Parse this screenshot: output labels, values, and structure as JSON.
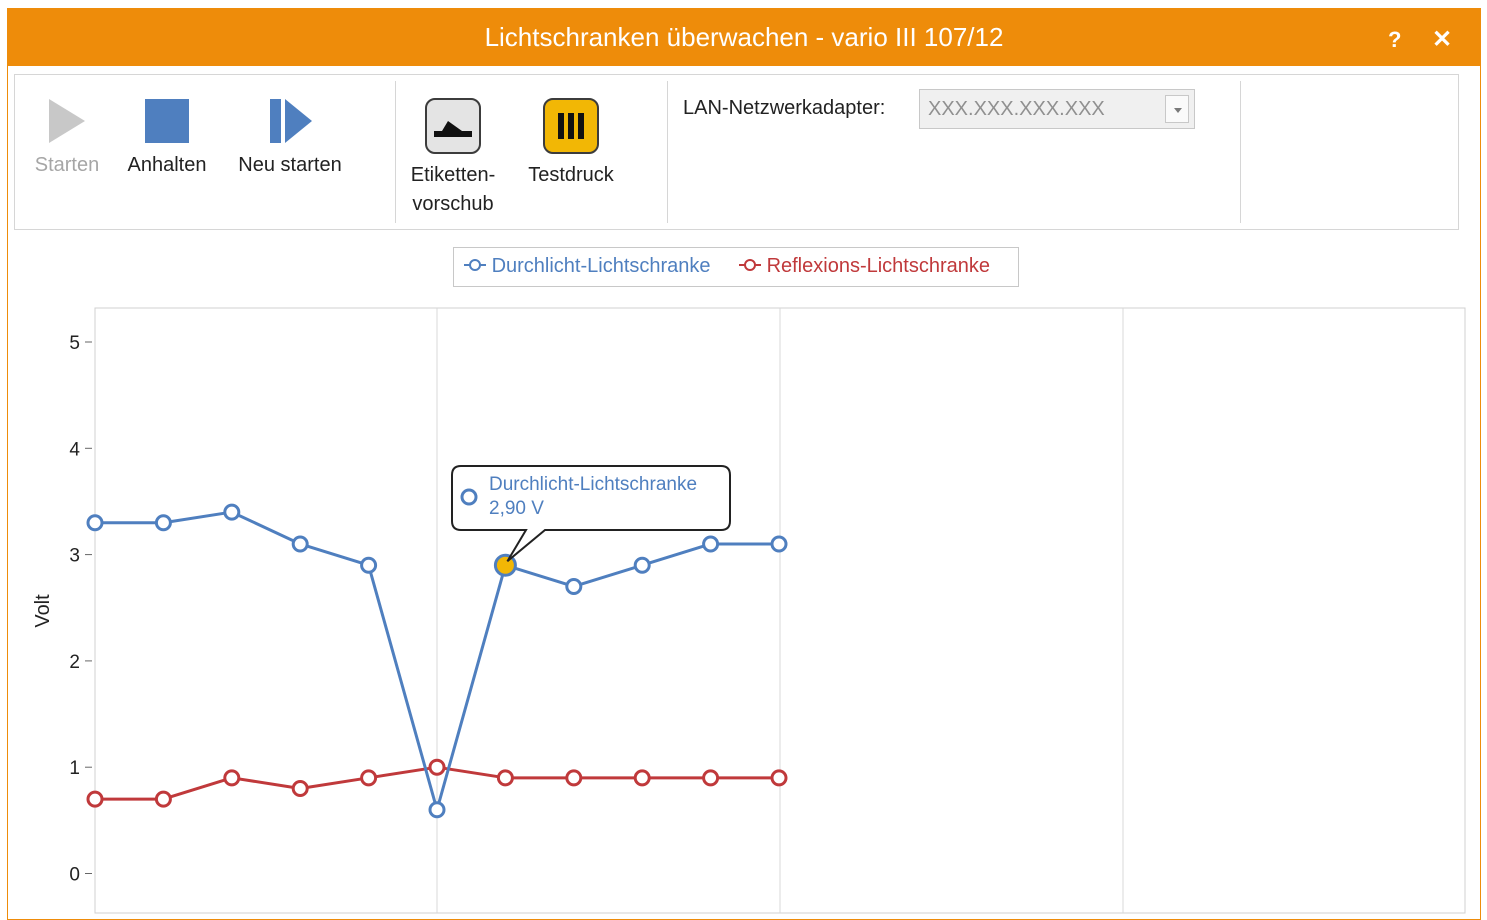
{
  "window": {
    "title": "Lichtschranken überwachen - vario III 107/12",
    "help_label": "?",
    "close_label": "✕"
  },
  "toolbar": {
    "start_label": "Starten",
    "stop_label": "Anhalten",
    "restart_label": "Neu starten",
    "feed_label_line1": "Etiketten-",
    "feed_label_line2": "vorschub",
    "testprint_label": "Testdruck"
  },
  "lan": {
    "label": "LAN-Netzwerkadapter:",
    "value": "XXX.XXX.XXX.XXX"
  },
  "colors": {
    "accent": "#ee8c0a",
    "series_blue": "#4f7fbf",
    "series_red": "#c0393b",
    "highlight": "#f2b705"
  },
  "tooltip": {
    "series": "Durchlicht-Lichtschranke",
    "value": "2,90 V"
  },
  "chart_data": {
    "type": "line",
    "ylabel": "Volt",
    "ylim": [
      0,
      5
    ],
    "yticks": [
      "0",
      "1",
      "2",
      "3",
      "4",
      "5"
    ],
    "x": [
      0,
      1,
      2,
      3,
      4,
      5,
      6,
      7,
      8,
      9,
      10
    ],
    "grid": "vertical",
    "legend": "top",
    "series": [
      {
        "name": "Durchlicht-Lichtschranke",
        "values": [
          3.3,
          3.3,
          3.4,
          3.1,
          2.9,
          0.6,
          2.9,
          2.7,
          2.9,
          3.1,
          3.1
        ]
      },
      {
        "name": "Reflexions-Lichtschranke",
        "values": [
          0.7,
          0.7,
          0.9,
          0.8,
          0.9,
          1.0,
          0.9,
          0.9,
          0.9,
          0.9,
          0.9
        ]
      }
    ],
    "highlighted_point": {
      "series": 0,
      "index": 6
    }
  }
}
